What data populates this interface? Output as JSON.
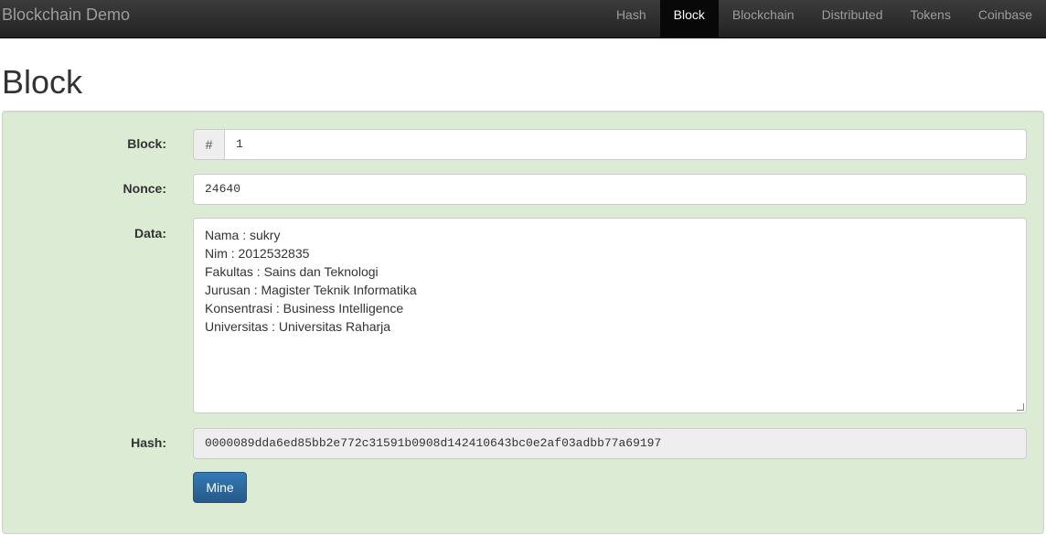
{
  "navbar": {
    "brand": "Blockchain Demo",
    "items": [
      {
        "label": "Hash",
        "active": false
      },
      {
        "label": "Block",
        "active": true
      },
      {
        "label": "Blockchain",
        "active": false
      },
      {
        "label": "Distributed",
        "active": false
      },
      {
        "label": "Tokens",
        "active": false
      },
      {
        "label": "Coinbase",
        "active": false
      }
    ]
  },
  "page": {
    "title": "Block"
  },
  "form": {
    "block_label": "Block:",
    "block_addon": "#",
    "block_value": "1",
    "nonce_label": "Nonce:",
    "nonce_value": "24640",
    "data_label": "Data:",
    "data_lines": [
      "Nama : sukry",
      "Nim : 2012532835",
      "Fakultas : Sains dan Teknologi",
      "Jurusan : Magister Teknik Informatika",
      "Konsentrasi : Business Intelligence",
      "Universitas : Universitas Raharja"
    ],
    "hash_label": "Hash:",
    "hash_value": "0000089dda6ed85bb2e772c31591b0908d142410643bc0e2af03adbb77a69197",
    "mine_label": "Mine"
  },
  "colors": {
    "well_valid": "#dbebd4",
    "navbar": "#222222",
    "button_primary": "#337ab7"
  }
}
